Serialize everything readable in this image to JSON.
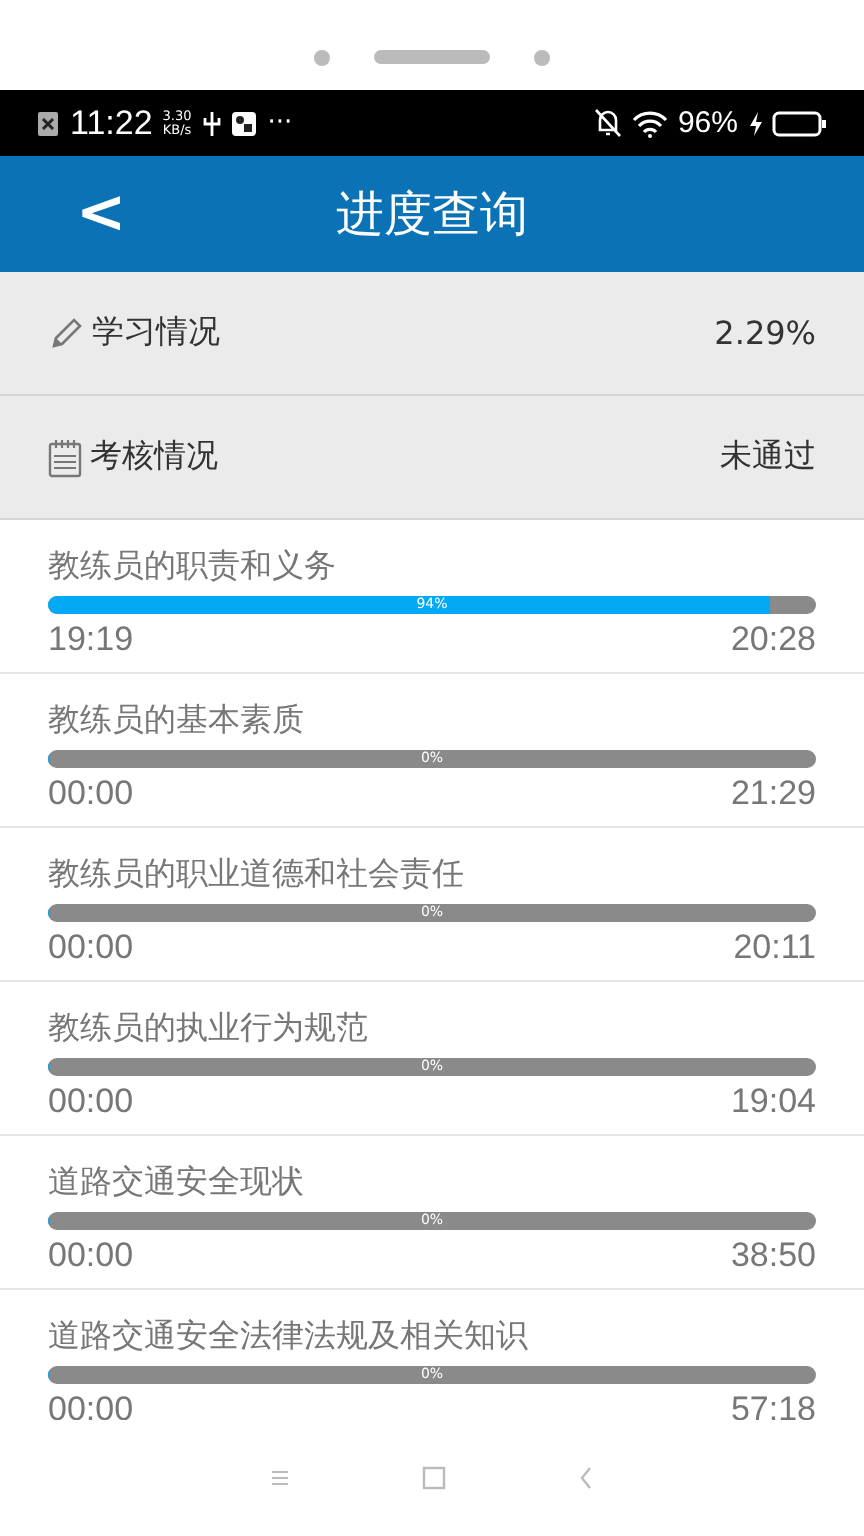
{
  "status_bar": {
    "time": "11:22",
    "speed": "3.30",
    "speed_unit": "KB/s",
    "more": "···",
    "battery": "96%"
  },
  "header": {
    "back": "<",
    "title": "进度查询"
  },
  "summary": [
    {
      "kind": "study",
      "label": "学习情况",
      "value": "2.29%"
    },
    {
      "kind": "exam",
      "label": "考核情况",
      "value": "未通过"
    }
  ],
  "lessons": [
    {
      "title": "教练员的职责和义务",
      "level": 0.94,
      "percent": "94%",
      "elapsed": "19:19",
      "total": "20:28"
    },
    {
      "title": "教练员的基本素质",
      "level": 0,
      "percent": "0%",
      "elapsed": "00:00",
      "total": "21:29"
    },
    {
      "title": "教练员的职业道德和社会责任",
      "level": 0,
      "percent": "0%",
      "elapsed": "00:00",
      "total": "20:11"
    },
    {
      "title": "教练员的执业行为规范",
      "level": 0,
      "percent": "0%",
      "elapsed": "00:00",
      "total": "19:04"
    },
    {
      "title": "道路交通安全现状",
      "level": 0,
      "percent": "0%",
      "elapsed": "00:00",
      "total": "38:50"
    },
    {
      "title": "道路交通安全法律法规及相关知识",
      "level": 0,
      "percent": "0%",
      "elapsed": "00:00",
      "total": "57:18"
    }
  ]
}
